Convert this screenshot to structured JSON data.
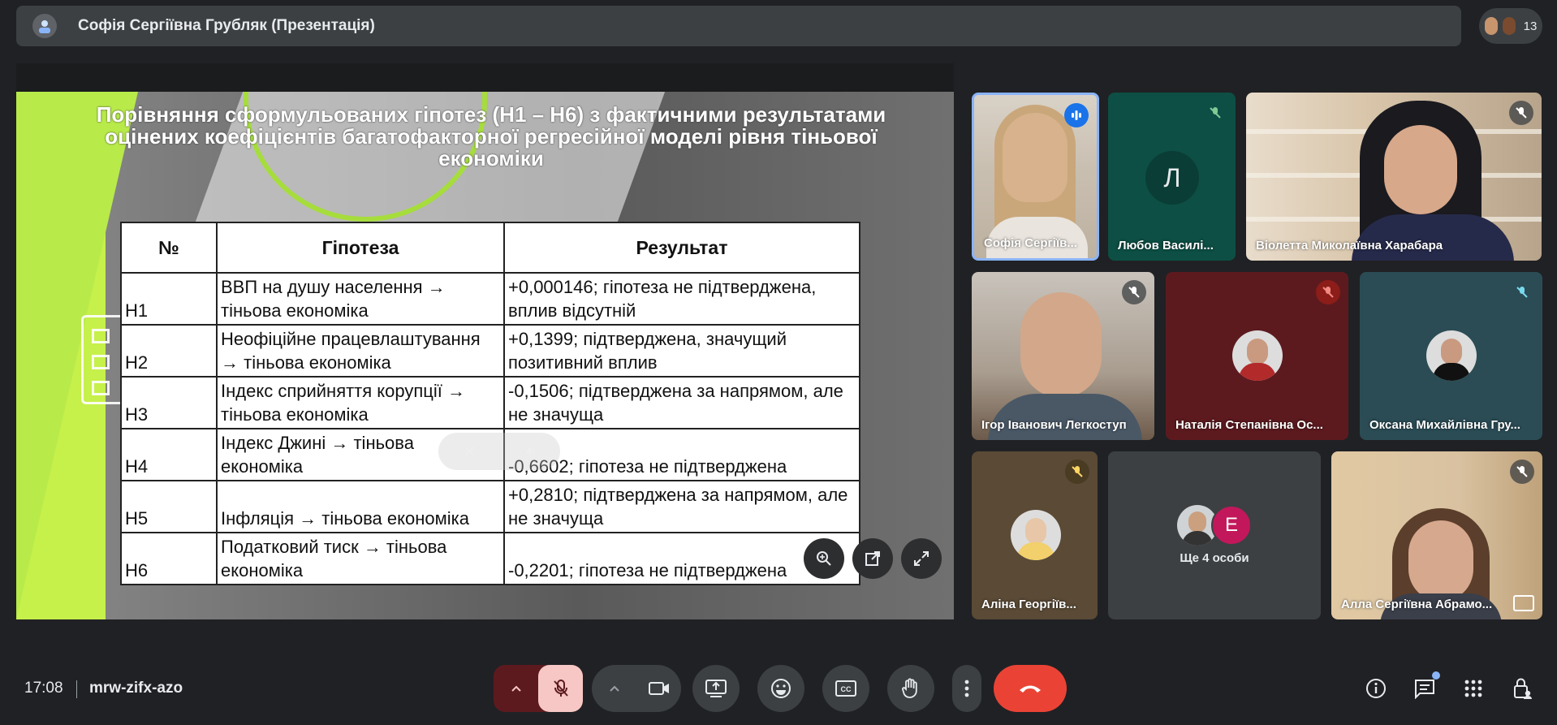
{
  "topbar": {
    "title": "Софія Сергіївна Грубляк (Презентація)",
    "participant_count": "13"
  },
  "slide": {
    "heading_line1": "Порівняння сформульованих гіпотез (Н1 – Н6) з фактичними результатами",
    "heading_line2": "оцінених коефіцієнтів багатофакторної регресійної моделі рівня тіньової економіки",
    "columns": [
      "№",
      "Гіпотеза",
      "Результат"
    ],
    "rows": [
      {
        "num": "Н1",
        "hypothesis": "ВВП на душу населення → тіньова економіка",
        "result": "+0,000146; гіпотеза не підтверджена, вплив відсутній"
      },
      {
        "num": "Н2",
        "hypothesis": "Неофіційне працевлаштування → тіньова економіка",
        "result": "+0,1399; підтверджена, значущий позитивний вплив"
      },
      {
        "num": "Н3",
        "hypothesis": "Індекс сприйняття корупції → тіньова економіка",
        "result": "-0,1506; підтверджена за напрямом, але не значуща"
      },
      {
        "num": "Н4",
        "hypothesis": "Індекс Джині → тіньова економіка",
        "result": "-0,6602; гіпотеза не підтверджена"
      },
      {
        "num": "Н5",
        "hypothesis": "Інфляція → тіньова економіка",
        "result": "+0,2810; підтверджена за напрямом, але не значуща"
      },
      {
        "num": "Н6",
        "hypothesis": "Податковий тиск → тіньова економіка",
        "result": "-0,2201; гіпотеза не підтверджена"
      }
    ]
  },
  "participants": {
    "sofia": "Софія Сергіїв...",
    "lyubov": "Любов Василі...",
    "lyubov_initial": "Л",
    "violetta": "Віолетта Миколаївна Харабара",
    "igor": "Ігор Іванович Легкоступ",
    "natalia": "Наталія Степанівна Ос...",
    "oksana": "Оксана Михайлівна Гру...",
    "alina": "Аліна Георгіїв...",
    "more_label": "Ще 4 особи",
    "more_initial": "Е",
    "alla": "Алла Сергіївна Абрамо..."
  },
  "bottom": {
    "time": "17:08",
    "meeting_code": "mrw-zifx-azo"
  },
  "colors": {
    "end_call": "#ea4335",
    "accent": "#8ab4f8",
    "slide_green": "#c6f04a"
  }
}
